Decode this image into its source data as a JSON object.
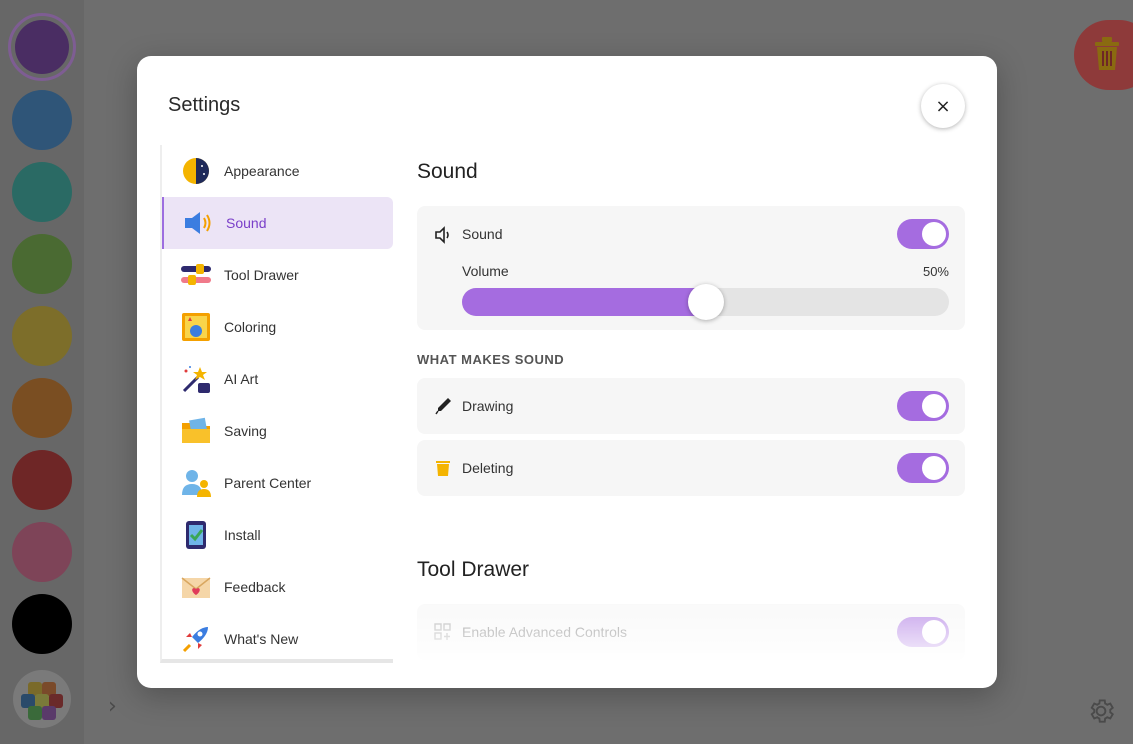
{
  "modal": {
    "title": "Settings",
    "close_label": "×"
  },
  "sidebar": {
    "items": [
      {
        "label": "Appearance",
        "icon": "sun-moon-icon"
      },
      {
        "label": "Sound",
        "icon": "speaker-icon",
        "active": true
      },
      {
        "label": "Tool Drawer",
        "icon": "sliders-icon"
      },
      {
        "label": "Coloring",
        "icon": "coloring-book-icon"
      },
      {
        "label": "AI Art",
        "icon": "magic-wand-icon"
      },
      {
        "label": "Saving",
        "icon": "folder-icon"
      },
      {
        "label": "Parent Center",
        "icon": "parent-icon"
      },
      {
        "label": "Install",
        "icon": "phone-install-icon"
      },
      {
        "label": "Feedback",
        "icon": "envelope-heart-icon"
      },
      {
        "label": "What's New",
        "icon": "rocket-icon"
      }
    ]
  },
  "content": {
    "sound_heading": "Sound",
    "sound_toggle_label": "Sound",
    "sound_enabled": true,
    "volume_label": "Volume",
    "volume_value": "50%",
    "volume_fraction": 0.5,
    "what_makes_sound_label": "WHAT MAKES SOUND",
    "drawing_label": "Drawing",
    "drawing_enabled": true,
    "deleting_label": "Deleting",
    "deleting_enabled": true,
    "tool_drawer_heading": "Tool Drawer",
    "advanced_controls_label": "Enable Advanced Controls",
    "advanced_controls_enabled": true
  },
  "colors": {
    "accent": "#a56ce0",
    "active_nav_bg": "#ece4f6",
    "swatches": [
      "#4a2d63",
      "#2f5578",
      "#2a6a64",
      "#4a6a32",
      "#7d6e2a",
      "#7a4e22",
      "#6e2626",
      "#7e4458",
      "#000000"
    ]
  }
}
